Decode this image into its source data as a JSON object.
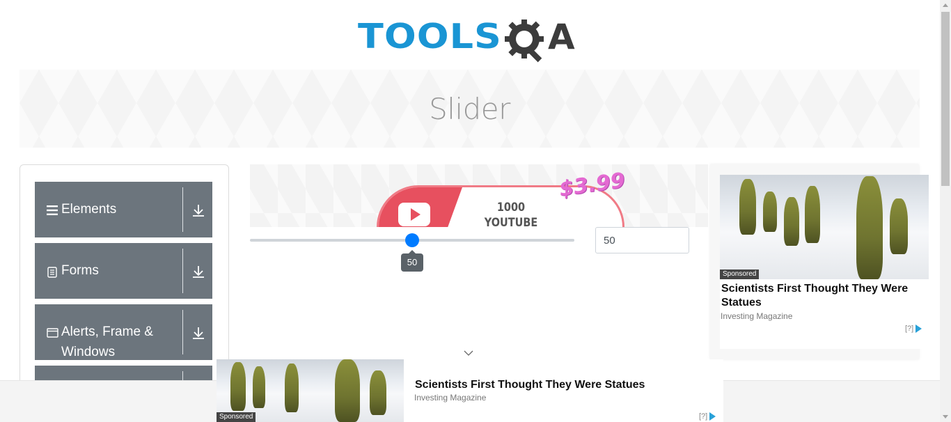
{
  "header": {
    "logo_tools": "TOOLS",
    "logo_a": "A",
    "logo_alt": "TOOLSQA"
  },
  "banner": {
    "title": "Slider"
  },
  "sidebar": {
    "groups": [
      {
        "label": "Elements",
        "icon": "hamburger-icon"
      },
      {
        "label": "Forms",
        "icon": "document-icon"
      },
      {
        "label": "Alerts, Frame & Windows",
        "label_line1": "Alerts, Frame &",
        "label_line2": "Windows",
        "icon": "browser-window-icon"
      },
      {
        "label": "",
        "icon": ""
      }
    ]
  },
  "slider": {
    "value": 50,
    "min": 0,
    "max": 100,
    "tooltip": "50",
    "input_value": "50",
    "accent": "#007bff"
  },
  "promo": {
    "line1": "1000",
    "line2": "YOUTUBE VIEWS",
    "price": "$3.99"
  },
  "right_ad": {
    "sponsored": "Sponsored",
    "title": "Scientists First Thought They Were Statues",
    "source": "Investing Magazine",
    "choice": "[?]"
  },
  "bottom_ad": {
    "sponsored": "Sponsored",
    "title": "Scientists First Thought They Were Statues",
    "source": "Investing Magazine",
    "choice": "[?]"
  },
  "colors": {
    "brand_blue": "#1a95d4",
    "sidebar_bg": "#6c757d",
    "thumb": "#007bff"
  }
}
